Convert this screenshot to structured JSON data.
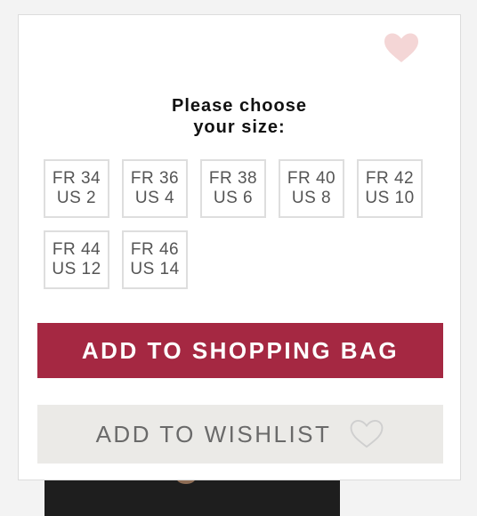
{
  "dialog": {
    "title_line1": "Please choose",
    "title_line2": "your size:"
  },
  "sizes": [
    {
      "fr": "FR 34",
      "us": "US 2"
    },
    {
      "fr": "FR 36",
      "us": "US 4"
    },
    {
      "fr": "FR 38",
      "us": "US 6"
    },
    {
      "fr": "FR 40",
      "us": "US 8"
    },
    {
      "fr": "FR 42",
      "us": "US 10"
    },
    {
      "fr": "FR 44",
      "us": "US 12"
    },
    {
      "fr": "FR 46",
      "us": "US 14"
    }
  ],
  "buttons": {
    "add_to_bag": "ADD TO SHOPPING BAG",
    "add_to_wishlist": "ADD TO WISHLIST"
  },
  "colors": {
    "accent": "#a52842",
    "favorite_heart": "#f4d6d6",
    "wishlist_bg": "#ebeae7"
  },
  "icons": {
    "favorite": "heart-icon",
    "wishlist": "heart-outline-icon"
  }
}
